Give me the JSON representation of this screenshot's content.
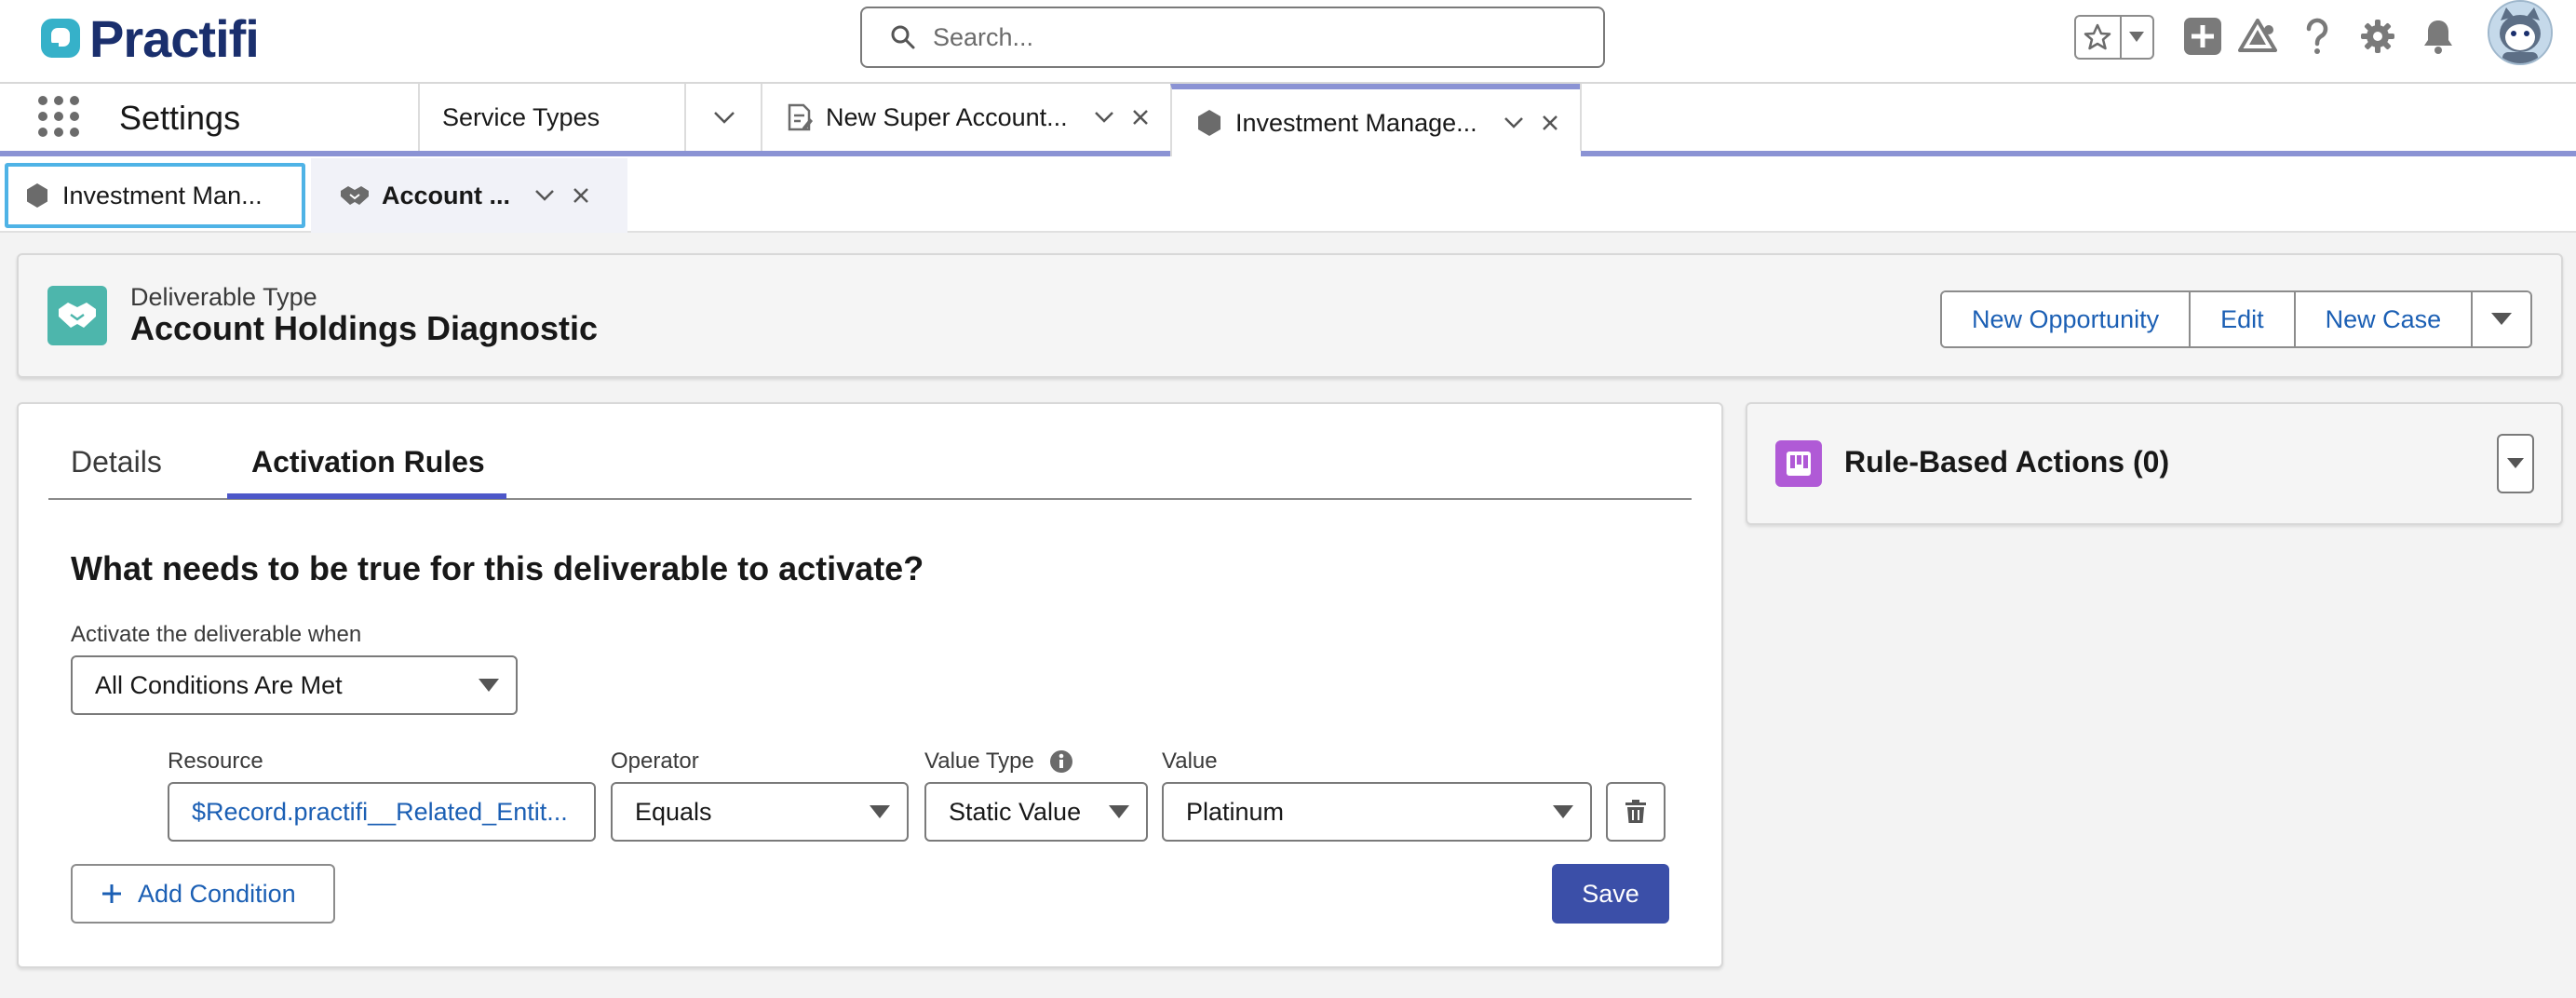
{
  "brand": {
    "name": "Practifi",
    "color": "#1a2f6d",
    "accent": "#36b1c9"
  },
  "search": {
    "placeholder": "Search..."
  },
  "header_icons": [
    "favorites-star-icon",
    "favorites-menu-icon",
    "global-create-icon",
    "trailhead-icon",
    "help-icon",
    "setup-gear-icon",
    "notifications-bell-icon",
    "user-avatar"
  ],
  "nav": {
    "app_name": "Settings",
    "tabs": [
      {
        "label": "Service Types",
        "icon": "none",
        "closable": false
      },
      {
        "label": "New Super Account...",
        "icon": "note-icon",
        "closable": true
      },
      {
        "label": "Investment Manage...",
        "icon": "hexagon-icon",
        "closable": true,
        "active": true
      }
    ]
  },
  "subtabs": [
    {
      "label": "Investment Man...",
      "icon": "hexagon-icon",
      "focused": true
    },
    {
      "label": "Account ...",
      "icon": "handshake-icon",
      "active": true,
      "closable": true
    }
  ],
  "record": {
    "object_label": "Deliverable Type",
    "title": "Account Holdings Diagnostic",
    "icon": "handshake-icon",
    "icon_color": "#4db6ac",
    "actions": [
      "New Opportunity",
      "Edit",
      "New Case"
    ]
  },
  "tabs": {
    "items": [
      "Details",
      "Activation Rules"
    ],
    "active": "Activation Rules",
    "accent": "#4d57c8"
  },
  "rules": {
    "question": "What needs to be true for this deliverable to activate?",
    "activate_label": "Activate the deliverable when",
    "activate_value": "All Conditions Are Met",
    "columns": {
      "resource": "Resource",
      "operator": "Operator",
      "value_type": "Value Type",
      "value": "Value"
    },
    "condition": {
      "resource": "$Record.practifi__Related_Entit...",
      "operator": "Equals",
      "value_type": "Static Value",
      "value": "Platinum"
    },
    "add_condition": "Add Condition",
    "save": "Save",
    "save_color": "#3b4fa8"
  },
  "side": {
    "title": "Rule-Based Actions (0)",
    "icon_color": "#b05ad6"
  }
}
